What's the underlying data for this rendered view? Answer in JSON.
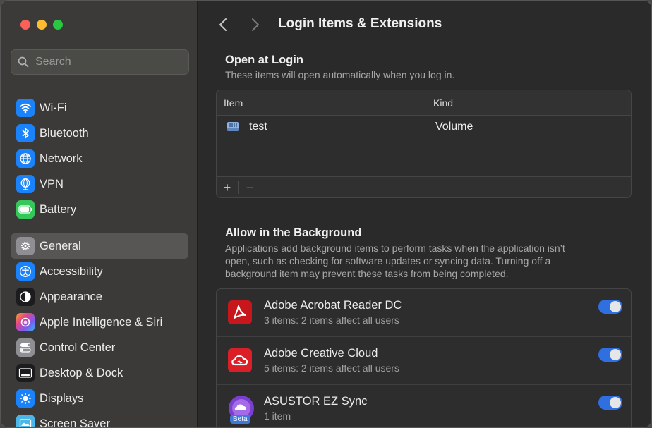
{
  "sidebar": {
    "search_placeholder": "Search",
    "items": [
      {
        "label": "Wi-Fi",
        "icon": "wifi-icon",
        "color": "#1a82fb"
      },
      {
        "label": "Bluetooth",
        "icon": "bluetooth-icon",
        "color": "#1a82fb"
      },
      {
        "label": "Network",
        "icon": "globe-icon",
        "color": "#1a82fb"
      },
      {
        "label": "VPN",
        "icon": "vpn-globe-icon",
        "color": "#1a82fb"
      },
      {
        "label": "Battery",
        "icon": "battery-icon",
        "color": "#34c759"
      },
      {
        "label": "General",
        "icon": "gear-icon",
        "color": "#8e8e93",
        "selected": true
      },
      {
        "label": "Accessibility",
        "icon": "accessibility-icon",
        "color": "#1a82fb"
      },
      {
        "label": "Appearance",
        "icon": "appearance-icon",
        "color": "#1c1c1e"
      },
      {
        "label": "Apple Intelligence & Siri",
        "icon": "siri-icon",
        "color": "#c84bd6"
      },
      {
        "label": "Control Center",
        "icon": "control-center-icon",
        "color": "#8e8e93"
      },
      {
        "label": "Desktop & Dock",
        "icon": "dock-icon",
        "color": "#1c1c1e"
      },
      {
        "label": "Displays",
        "icon": "sun-icon",
        "color": "#1a82fb"
      },
      {
        "label": "Screen Saver",
        "icon": "screen-saver-icon",
        "color": "#4bb6e8"
      }
    ]
  },
  "toolbar": {
    "title": "Login Items & Extensions"
  },
  "open_at_login": {
    "title": "Open at Login",
    "description": "These items will open automatically when you log in.",
    "columns": {
      "item": "Item",
      "kind": "Kind"
    },
    "rows": [
      {
        "name": "test",
        "kind": "Volume",
        "icon": "volume-icon"
      }
    ],
    "add_label": "+",
    "remove_label": "−"
  },
  "background": {
    "title": "Allow in the Background",
    "description_lines": [
      "Applications add background items to perform tasks when the application isn’t",
      "open, such as checking for software updates or syncing data. Turning off a",
      "background item may prevent these tasks from being completed."
    ],
    "items": [
      {
        "name": "Adobe Acrobat Reader DC",
        "detail": "3 items: 2 items affect all users",
        "enabled": true,
        "icon": "acrobat-icon"
      },
      {
        "name": "Adobe Creative Cloud",
        "detail": "5 items: 2 items affect all users",
        "enabled": true,
        "icon": "creative-cloud-icon"
      },
      {
        "name": "ASUSTOR EZ Sync",
        "detail": "1 item",
        "enabled": true,
        "icon": "ez-sync-icon",
        "badge": "Beta"
      }
    ]
  },
  "colors": {
    "accent": "#2f6fe0",
    "sidebar_bg": "#3b3a38",
    "content_bg": "#2a2a2a"
  }
}
